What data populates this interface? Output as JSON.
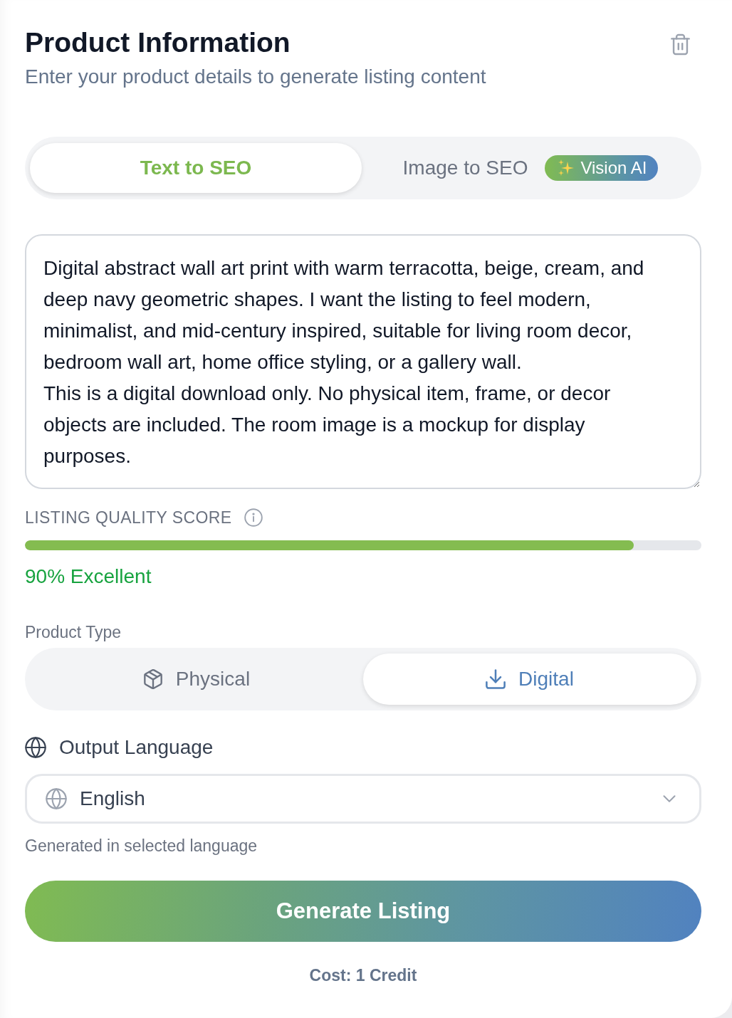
{
  "header": {
    "title": "Product Information",
    "subtitle": "Enter your product details to generate listing content"
  },
  "mode_tabs": [
    {
      "label": "Text to SEO",
      "selected": true
    },
    {
      "label": "Image to SEO",
      "selected": false,
      "badge": "Vision AI"
    }
  ],
  "description": {
    "value": "Digital abstract wall art print with warm terracotta, beige, cream, and deep navy geometric shapes. I want the listing to feel modern, minimalist, and mid-century inspired, suitable for living room decor, bedroom wall art, home office styling, or a gallery wall.\nThis is a digital download only. No physical item, frame, or decor objects are included. The room image is a mockup for display purposes."
  },
  "quality_score": {
    "label": "LISTING QUALITY SCORE",
    "level": 0.9,
    "reading": "90% Excellent"
  },
  "product_type": {
    "label": "Product Type",
    "options": [
      {
        "label": "Physical",
        "kind": "box",
        "selected": false
      },
      {
        "label": "Digital",
        "kind": "download",
        "selected": true
      }
    ]
  },
  "output_language": {
    "label": "Output Language",
    "value": "English",
    "hint": "Generated in selected language"
  },
  "generate_button": {
    "label": "Generate Listing"
  },
  "cost": "Cost: 1 Credit"
}
